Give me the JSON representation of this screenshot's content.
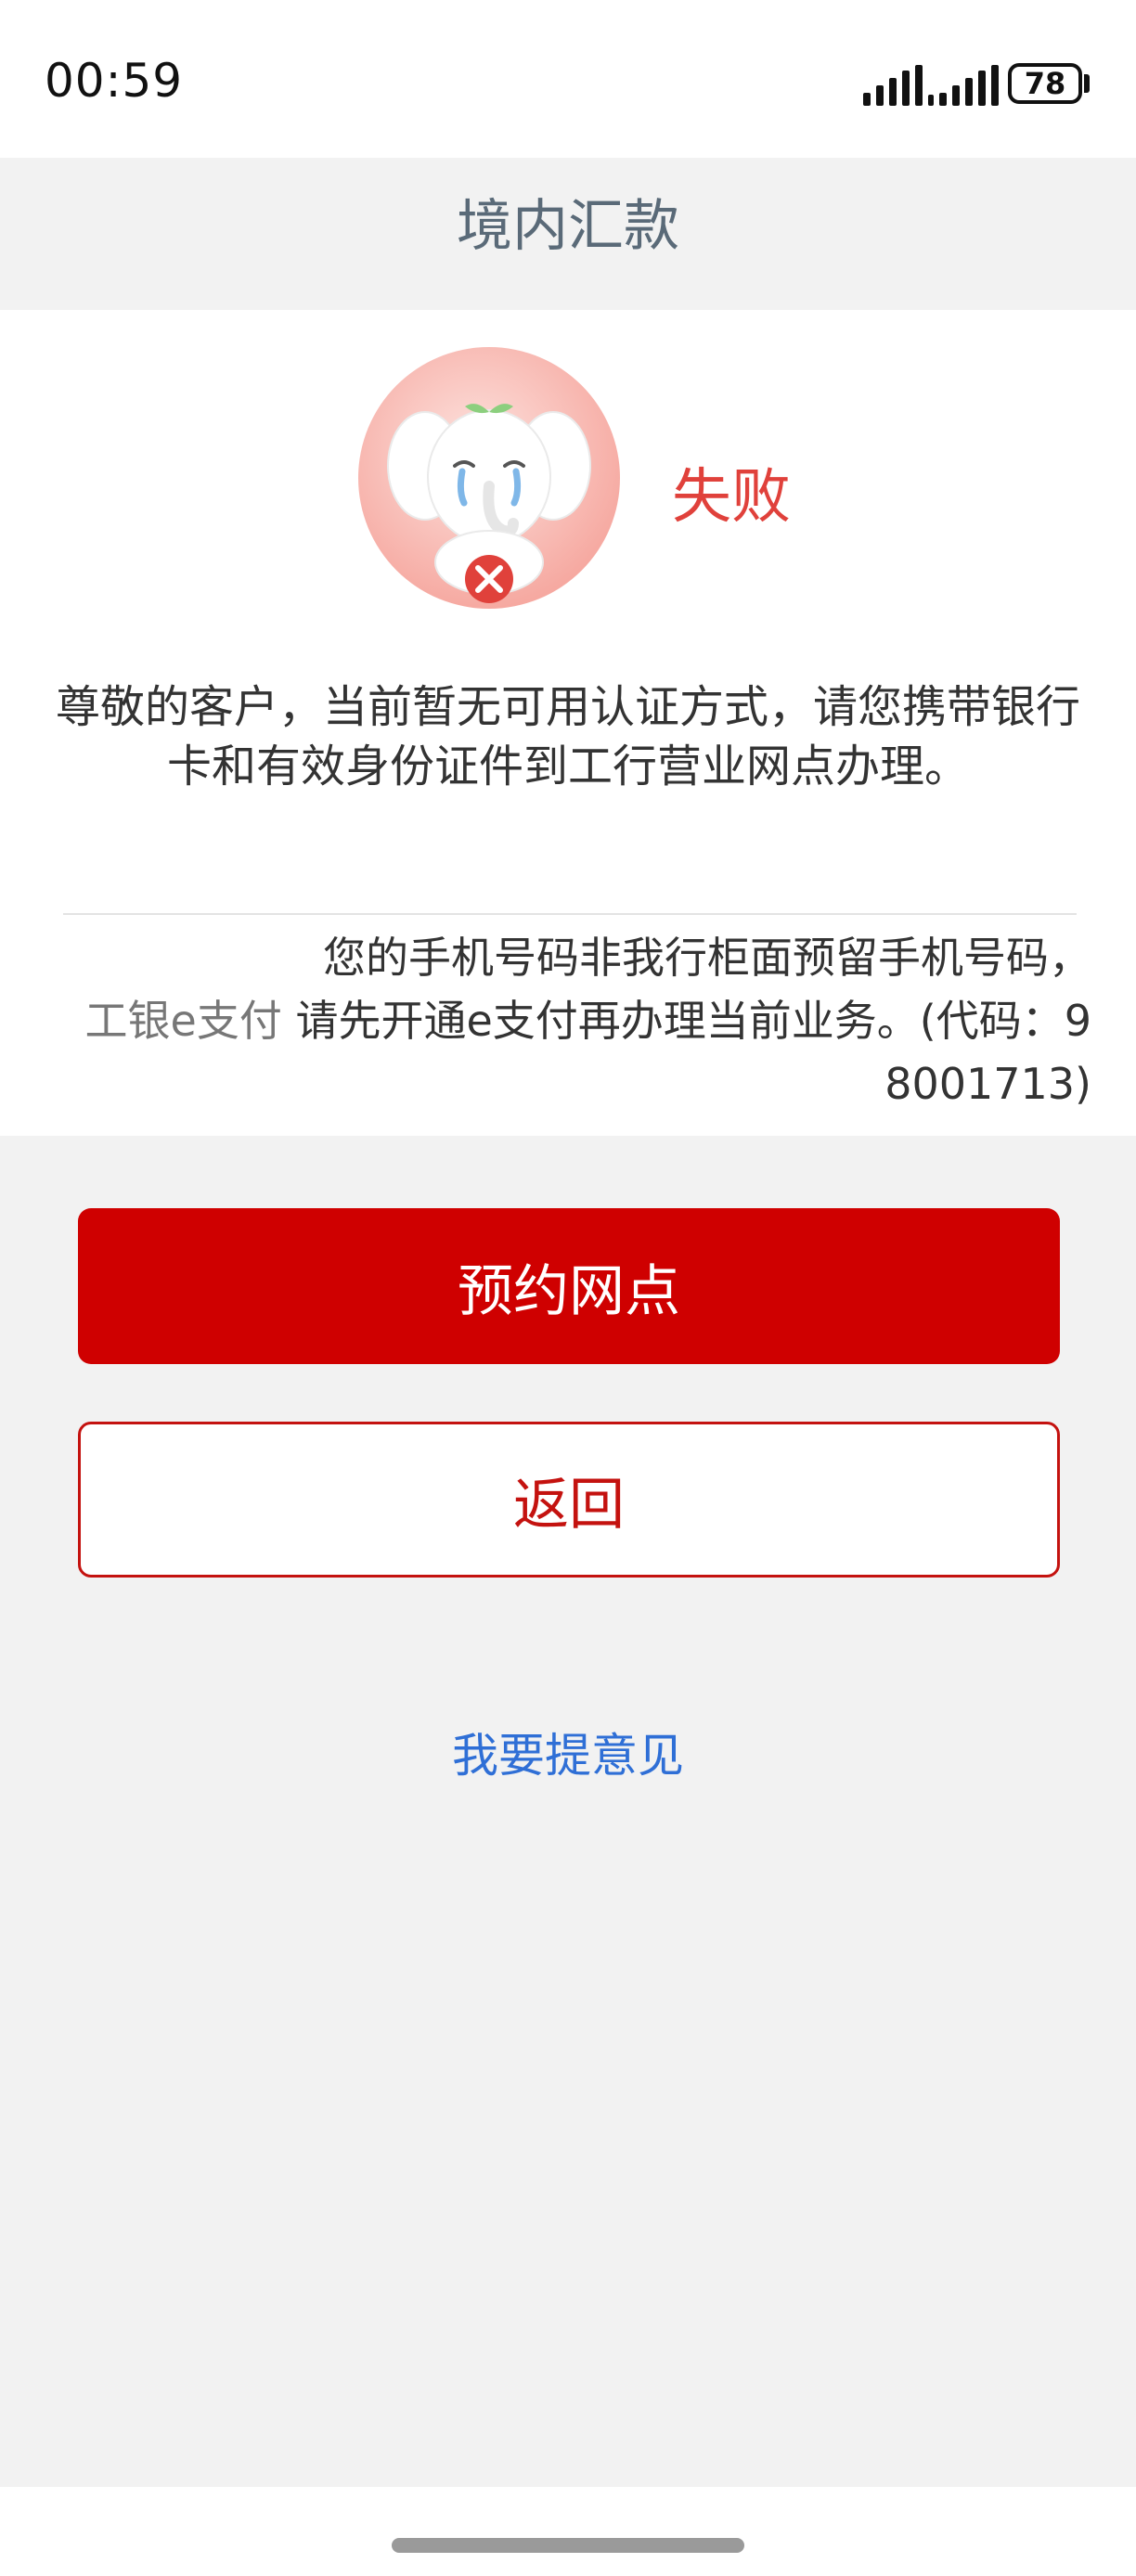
{
  "status_bar": {
    "time": "00:59",
    "battery": "78"
  },
  "nav": {
    "title": "境内汇款"
  },
  "result": {
    "status": "失败",
    "mascot_icon": "crying-elephant-failure-icon",
    "message": "尊敬的客户，当前暂无可用认证方式，请您携带银行卡和有效身份证件到工行营业网点办理。",
    "detail_line1": "您的手机号码非我行柜面预留手机号码，",
    "detail_label": "工银e支付",
    "detail_line2": " 请先开通e支付再办理当前业务。(代码：9",
    "detail_line3": "8001713)"
  },
  "actions": {
    "primary_label": "预约网点",
    "secondary_label": "返回",
    "feedback_label": "我要提意见"
  },
  "colors": {
    "brand_red": "#cf0000",
    "status_red": "#e0413b",
    "link_blue": "#2f6fd6"
  }
}
